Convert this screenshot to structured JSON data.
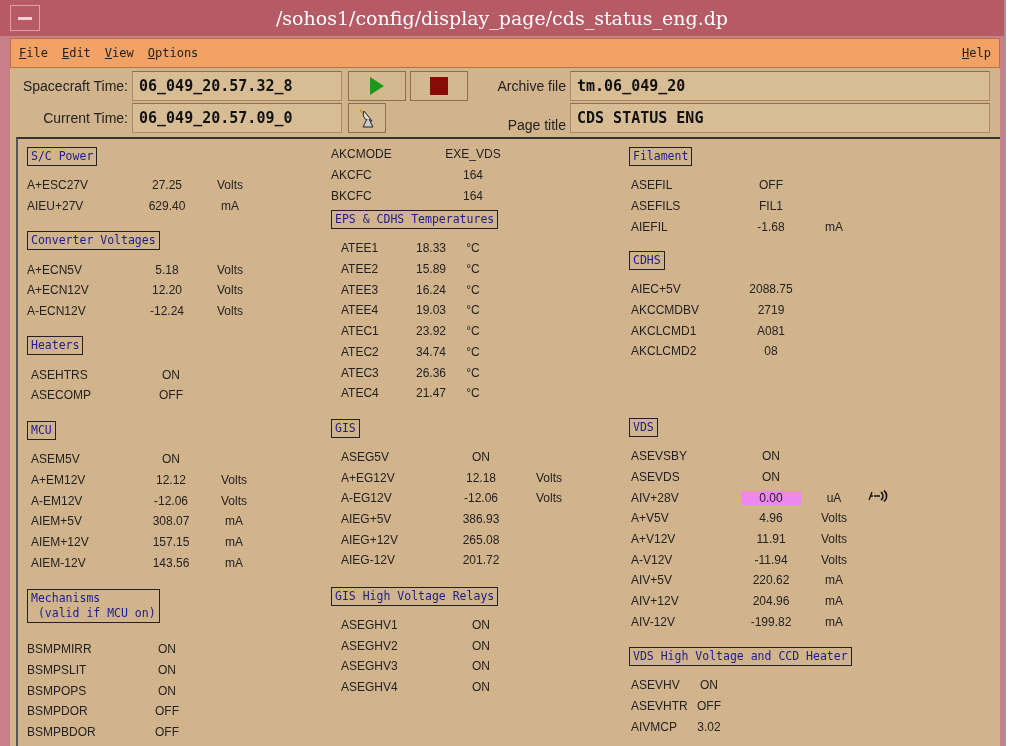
{
  "window": {
    "title": "/sohos1/config/display_page/cds_status_eng.dp"
  },
  "menu": {
    "items": [
      "File",
      "Edit",
      "View",
      "Options"
    ],
    "help": "Help"
  },
  "toolbar": {
    "spacecraft_time": {
      "label": "Spacecraft Time:",
      "value": "06_049_20.57.32_8"
    },
    "current_time": {
      "label": "Current Time:",
      "value": "06_049_20.57.09_0"
    },
    "archive_file": {
      "label": "Archive file",
      "value": "tm.06_049_20"
    },
    "page_title": {
      "label": "Page title",
      "value": "CDS STATUS ENG"
    }
  },
  "columns": [
    {
      "sections": [
        {
          "title": "S/C Power",
          "rows": [
            {
              "name": "A+ESC27V",
              "value": "27.25",
              "unit": "Volts",
              "alarm": false
            },
            {
              "name": "AIEU+27V",
              "value": "629.40",
              "unit": "mA",
              "alarm": false
            }
          ]
        },
        {
          "title": "Converter Voltages",
          "rows": [
            {
              "name": "A+ECN5V",
              "value": "5.18",
              "unit": "Volts",
              "alarm": false
            },
            {
              "name": "A+ECN12V",
              "value": "12.20",
              "unit": "Volts",
              "alarm": false
            },
            {
              "name": "A-ECN12V",
              "value": "-12.24",
              "unit": "Volts",
              "alarm": false
            }
          ]
        },
        {
          "title": "Heaters",
          "rows": [
            {
              "name": "ASEHTRS",
              "value": "ON",
              "alarm": false
            },
            {
              "name": "ASECOMP",
              "value": "OFF",
              "alarm": false
            }
          ]
        },
        {
          "title": "MCU",
          "rows": [
            {
              "name": "ASEM5V",
              "value": "ON",
              "alarm": false
            },
            {
              "name": "A+EM12V",
              "value": "12.12",
              "unit": "Volts",
              "alarm": false
            },
            {
              "name": "A-EM12V",
              "value": "-12.06",
              "unit": "Volts",
              "alarm": false
            },
            {
              "name": "AIEM+5V",
              "value": "308.07",
              "unit": "mA",
              "alarm": false
            },
            {
              "name": "AIEM+12V",
              "value": "157.15",
              "unit": "mA",
              "alarm": false
            },
            {
              "name": "AIEM-12V",
              "value": "143.56",
              "unit": "mA",
              "alarm": false
            }
          ]
        },
        {
          "title": "Mechanisms\n (valid if MCU on)",
          "rows": [
            {
              "name": "BSMPMIRR",
              "value": "ON",
              "alarm": false
            },
            {
              "name": "BSMPSLIT",
              "value": "ON",
              "alarm": false
            },
            {
              "name": "BSMPOPS",
              "value": "ON",
              "alarm": false
            },
            {
              "name": "BSMPDOR",
              "value": "OFF",
              "alarm": false
            },
            {
              "name": "BSMPBDOR",
              "value": "OFF",
              "alarm": false
            }
          ]
        }
      ]
    },
    {
      "sections": [
        {
          "rows": [
            {
              "name": "AKCMODE",
              "value": "EXE_VDS",
              "alarm": false
            },
            {
              "name": "AKCFC",
              "value": "164",
              "alarm": false
            },
            {
              "name": "BKCFC",
              "value": "164",
              "alarm": false
            }
          ]
        },
        {
          "title": "EPS & CDHS Temperatures",
          "rows": [
            {
              "name": "ATEE1",
              "value": "18.33",
              "unit": "°C",
              "alarm": false
            },
            {
              "name": "ATEE2",
              "value": "15.89",
              "unit": "°C",
              "alarm": false
            },
            {
              "name": "ATEE3",
              "value": "16.24",
              "unit": "°C",
              "alarm": false
            },
            {
              "name": "ATEE4",
              "value": "19.03",
              "unit": "°C",
              "alarm": false
            },
            {
              "name": "ATEC1",
              "value": "23.92",
              "unit": "°C",
              "alarm": false
            },
            {
              "name": "ATEC2",
              "value": "34.74",
              "unit": "°C",
              "alarm": false
            },
            {
              "name": "ATEC3",
              "value": "26.36",
              "unit": "°C",
              "alarm": false
            },
            {
              "name": "ATEC4",
              "value": "21.47",
              "unit": "°C",
              "alarm": false
            }
          ]
        },
        {
          "title": "GIS",
          "rows": [
            {
              "name": "ASEG5V",
              "value": "ON",
              "alarm": false
            },
            {
              "name": "A+EG12V",
              "value": "12.18",
              "unit": "Volts",
              "alarm": false
            },
            {
              "name": "A-EG12V",
              "value": "-12.06",
              "unit": "Volts",
              "alarm": false
            },
            {
              "name": "AIEG+5V",
              "value": "386.93",
              "alarm": false
            },
            {
              "name": "AIEG+12V",
              "value": "265.08",
              "alarm": false
            },
            {
              "name": "AIEG-12V",
              "value": "201.72",
              "alarm": false
            }
          ]
        },
        {
          "title": "GIS High Voltage Relays",
          "rows": [
            {
              "name": "ASEGHV1",
              "value": "ON",
              "alarm": false
            },
            {
              "name": "ASEGHV2",
              "value": "ON",
              "alarm": false
            },
            {
              "name": "ASEGHV3",
              "value": "ON",
              "alarm": false
            },
            {
              "name": "ASEGHV4",
              "value": "ON",
              "alarm": false
            }
          ]
        }
      ]
    },
    {
      "sections": [
        {
          "title": "Filament",
          "rows": [
            {
              "name": "ASEFIL",
              "value": "OFF",
              "alarm": false
            },
            {
              "name": "ASEFILS",
              "value": "FIL1",
              "alarm": false
            },
            {
              "name": "AIEFIL",
              "value": "-1.68",
              "unit": "mA",
              "alarm": false
            }
          ]
        },
        {
          "title": "CDHS",
          "rows": [
            {
              "name": "AIEC+5V",
              "value": "2088.75",
              "alarm": false
            },
            {
              "name": "AKCCMDBV",
              "value": "2719",
              "alarm": false
            },
            {
              "name": "AKCLCMD1",
              "value": "A081",
              "alarm": false
            },
            {
              "name": "AKCLCMD2",
              "value": "08",
              "alarm": false
            }
          ]
        },
        {
          "title": "VDS",
          "rows": [
            {
              "name": "ASEVSBY",
              "value": "ON",
              "alarm": false
            },
            {
              "name": "ASEVDS",
              "value": "ON",
              "alarm": false
            },
            {
              "name": "AIV+28V",
              "value": "0.00",
              "unit": "uA",
              "alarm": true
            },
            {
              "name": "A+V5V",
              "value": "4.96",
              "unit": "Volts",
              "alarm": false
            },
            {
              "name": "A+V12V",
              "value": "11.91",
              "unit": "Volts",
              "alarm": false
            },
            {
              "name": "A-V12V",
              "value": "-11.94",
              "unit": "Volts",
              "alarm": false
            },
            {
              "name": "AIV+5V",
              "value": "220.62",
              "unit": "mA",
              "alarm": false
            },
            {
              "name": "AIV+12V",
              "value": "204.96",
              "unit": "mA",
              "alarm": false
            },
            {
              "name": "AIV-12V",
              "value": "-199.82",
              "unit": "mA",
              "alarm": false
            }
          ]
        },
        {
          "title": "VDS High Voltage and CCD Heater",
          "rows": [
            {
              "name": "ASEVHV",
              "value": "ON",
              "alarm": false
            },
            {
              "name": "ASEVHTR",
              "value": "OFF",
              "alarm": false
            },
            {
              "name": "AIVMCP",
              "value": "3.02",
              "alarm": false
            }
          ]
        }
      ]
    }
  ]
}
